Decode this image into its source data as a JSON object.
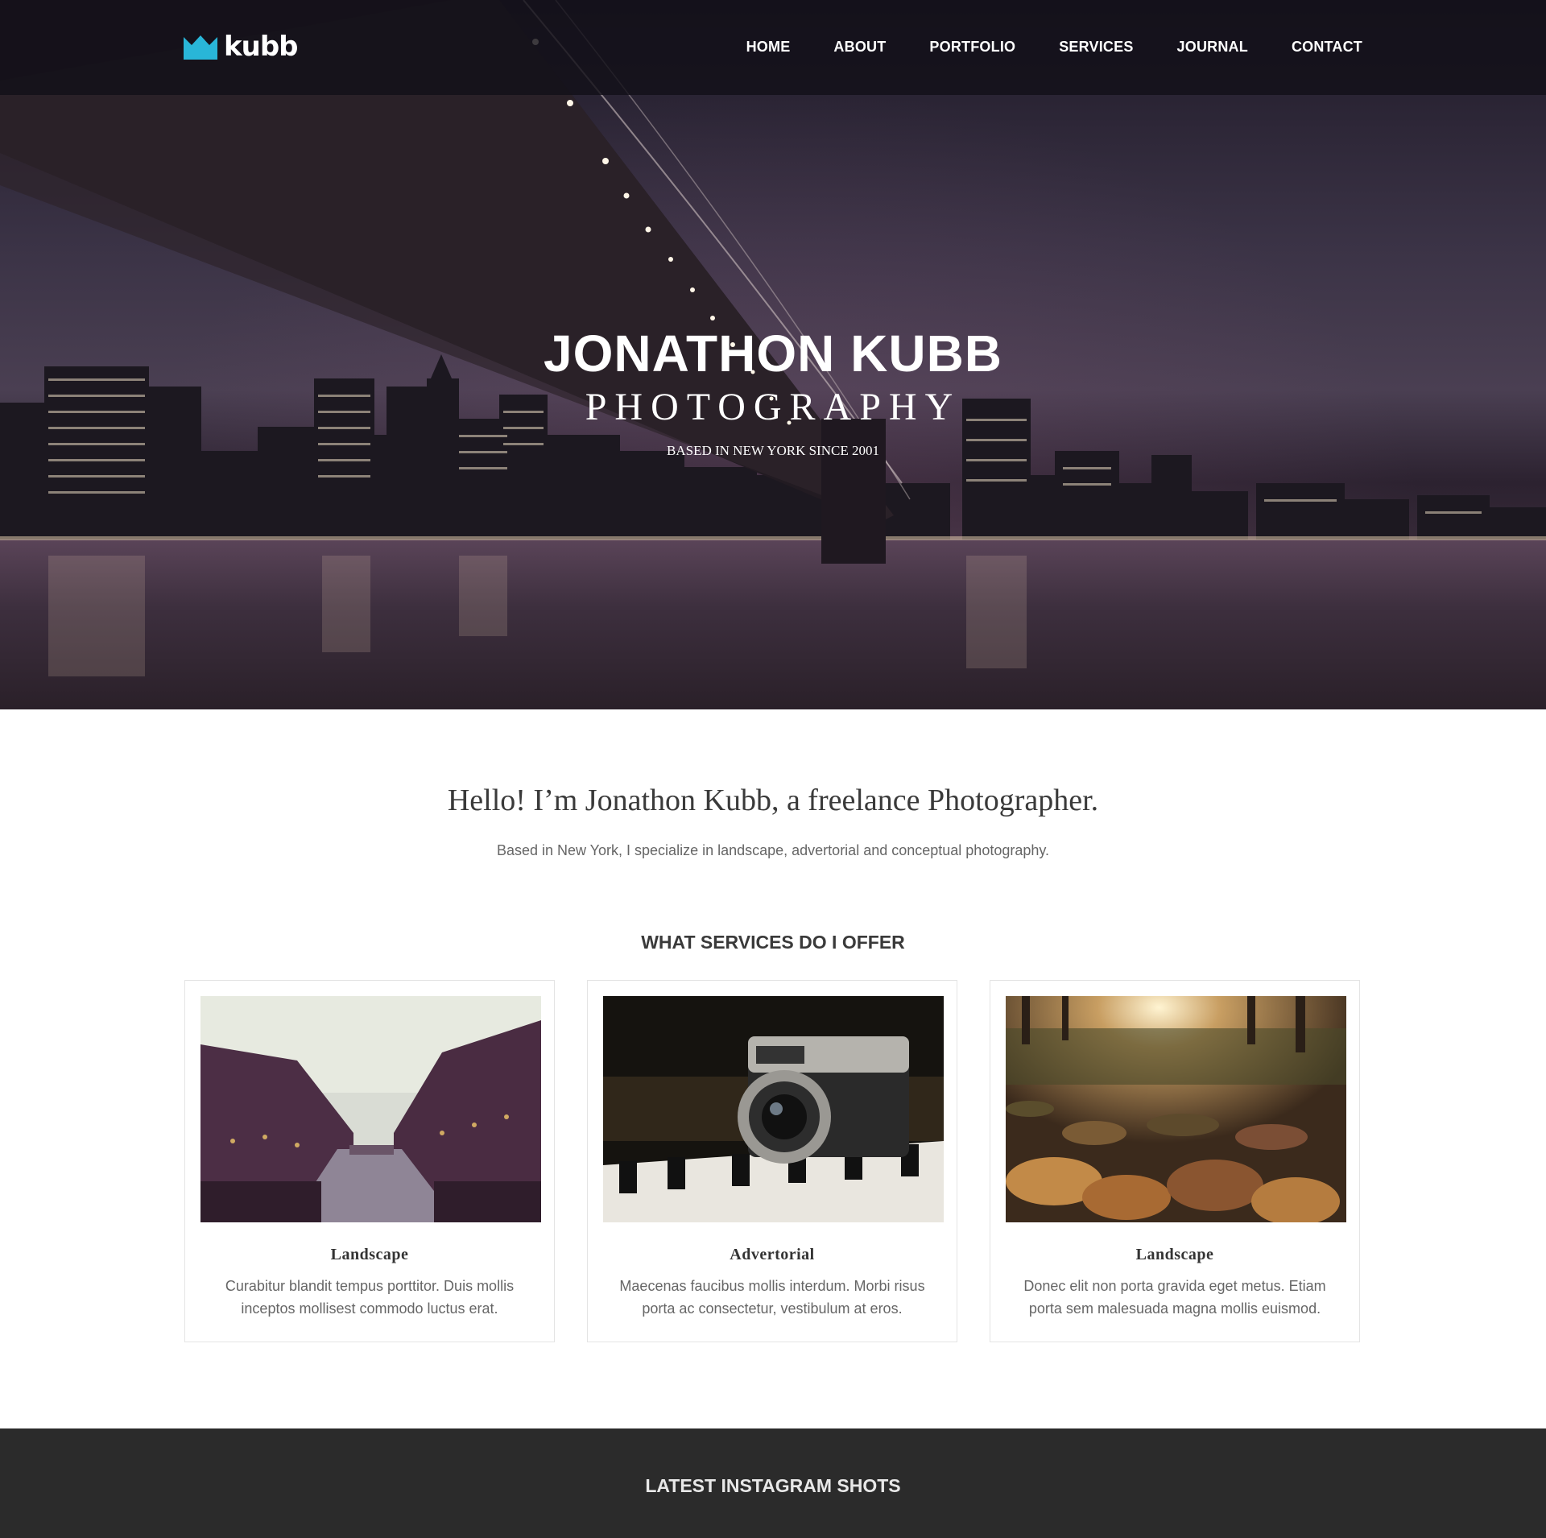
{
  "brand": {
    "logo_text": "kubb",
    "accent": "#29b6d8"
  },
  "nav": {
    "items": [
      "HOME",
      "ABOUT",
      "PORTFOLIO",
      "SERVICES",
      "JOURNAL",
      "CONTACT"
    ]
  },
  "hero": {
    "title": "JONATHON KUBB",
    "subtitle": "PHOTOGRAPHY",
    "tagline": "BASED IN NEW YORK SINCE 2001"
  },
  "intro": {
    "heading": "Hello! I’m Jonathon Kubb, a freelance Photographer.",
    "text": "Based in New York, I specialize in landscape, advertorial and conceptual photography."
  },
  "services": {
    "heading": "WHAT SERVICES DO I OFFER",
    "cards": [
      {
        "title": "Landscape",
        "text": "Curabitur blandit tempus porttitor. Duis mollis inceptos mollisest commodo luctus erat.",
        "image": "canal-city-photo"
      },
      {
        "title": "Advertorial",
        "text": "Maecenas faucibus mollis interdum. Morbi risus porta ac consectetur, vestibulum at eros.",
        "image": "vintage-camera-photo"
      },
      {
        "title": "Landscape",
        "text": "Donec elit non porta gravida eget metus. Etiam porta sem malesuada magna mollis euismod.",
        "image": "autumn-leaves-photo"
      }
    ]
  },
  "instagram": {
    "heading": "LATEST INSTAGRAM SHOTS"
  }
}
